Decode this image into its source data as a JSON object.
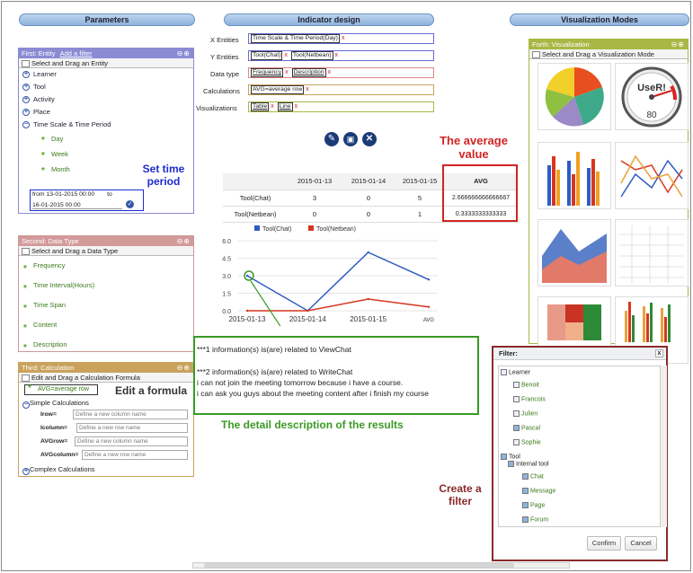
{
  "columns": {
    "parameters": "Parameters",
    "indicator": "Indicator design",
    "visualization": "Visualization Modes"
  },
  "entity": {
    "title": "First: Entity",
    "add_filter": "Add a filter",
    "subhead": "Select and Drag an Entity",
    "items": [
      "Learner",
      "Tool",
      "Activity",
      "Place",
      "Time Scale & Time Period"
    ],
    "time_children": [
      "Day",
      "Week",
      "Month"
    ],
    "from_label": "from",
    "from_value": "13-01-2015 00:00",
    "to_label": "to",
    "to_value": "16-01-2015 00:00"
  },
  "datatype": {
    "title": "Second: Data Type",
    "subhead": "Select and Drag a Data Type",
    "items": [
      "Frequency",
      "Time Interval(Hours)",
      "Time Span",
      "Content",
      "Description"
    ]
  },
  "calculation": {
    "title": "Third: Calculation",
    "subhead": "Edit and Drag a Calculation Formula",
    "formula": "AVG=average row",
    "simple": "Simple Calculations",
    "fields": [
      {
        "label": "Irow=",
        "placeholder": "Define a new column name"
      },
      {
        "label": "Icolumn=",
        "placeholder": "Define a new row name"
      },
      {
        "label": "AVGrow=",
        "placeholder": "Define a new column name"
      },
      {
        "label": "AVGcolumn=",
        "placeholder": "Define a new row name"
      }
    ],
    "complex": "Complex Calculations"
  },
  "indicator": {
    "x_label": "X Entities",
    "x_tag": "Time Scale & Time Period(Day)",
    "y_label": "Y Entities",
    "y_tags": [
      "Tool(Chat)",
      "Tool(Netbean)"
    ],
    "dtype_label": "Data type",
    "dtype_tags": [
      "Frequency",
      "Description"
    ],
    "calc_label": "Calculations",
    "calc_tag": "AVG=average row",
    "vis_label": "Visualizations",
    "vis_tags": [
      "Table",
      "Line"
    ],
    "remove_glyph": "x"
  },
  "table": {
    "headers": [
      "",
      "2015-01-13",
      "2015-01-14",
      "2015-01-15",
      "AVG"
    ],
    "rows": [
      [
        "Tool(Chat)",
        "3",
        "0",
        "5",
        "2.666666666666667"
      ],
      [
        "Tool(Netbean)",
        "0",
        "0",
        "1",
        "0.3333333333333"
      ]
    ]
  },
  "chart_data": {
    "type": "line",
    "categories": [
      "2015-01-13",
      "2015-01-14",
      "2015-01-15",
      "AVG"
    ],
    "series": [
      {
        "name": "Tool(Chat)",
        "values": [
          3,
          0,
          5,
          2.67
        ],
        "color": "#2e5bc6"
      },
      {
        "name": "Tool(Netbean)",
        "values": [
          0,
          0,
          1,
          0.33
        ],
        "color": "#d8361e"
      }
    ],
    "yticks": [
      "6.0",
      "4.5",
      "3.0",
      "1.5",
      "0.0"
    ],
    "ylim": [
      0,
      6
    ],
    "grid": true,
    "legend": "top"
  },
  "description": {
    "lines": [
      "***1 information(s) is(are) related to ViewChat",
      "***2 information(s) is(are) related to WriteChat",
      "i can not join the meeting tomorrow because i have a course.",
      "i can ask you guys about the meeting content after i finish my course"
    ]
  },
  "annotations": {
    "set_time": "Set time period",
    "average": "The average value",
    "edit_formula": "Edit a formula",
    "detail": "The detail description of the results",
    "create_filter": "Create a filter"
  },
  "visualization": {
    "title": "Forth: Visualization",
    "subhead": "Select and Drag a Visualization Mode",
    "gauge_label": "UseR!",
    "gauge_value": "80"
  },
  "filter": {
    "title": "Filter:",
    "close": "x",
    "learner": "Learner",
    "learners": [
      "Benoit",
      "Francois",
      "Julien",
      "Pascal",
      "Sophie"
    ],
    "learner_checked": [
      false,
      false,
      false,
      true,
      false
    ],
    "tool": "Tool",
    "internal": "Internal tool",
    "tools": [
      "Chat",
      "Message",
      "Page",
      "Forum"
    ],
    "confirm": "Confirm",
    "cancel": "Cancel"
  },
  "colors": {
    "entity": "#7c7cc9",
    "datatype": "#c98a8a",
    "calc": "#c9a25c",
    "vis": "#a8b845",
    "annotation_red": "#d22323",
    "annotation_blue": "#1e2bd0",
    "annotation_green": "#3a9a25"
  }
}
